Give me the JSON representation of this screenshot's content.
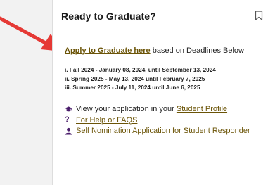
{
  "card": {
    "title": "Ready to Graduate?",
    "apply_link": "Apply to Graduate here",
    "apply_suffix": "based on Deadlines Below",
    "deadlines": [
      "i. Fall 2024 - January 08, 2024, until September 13, 2024",
      "ii. Spring 2025 - May 13, 2024 until February 7, 2025",
      "iii. Summer 2025 - July 11, 2024 until June 6, 2025"
    ],
    "resources": {
      "view_prefix": "View your application in your",
      "student_profile_link": "Student Profile",
      "help_link": "For Help or FAQS",
      "nomination_link": "Self Nomination Application for Student Responder"
    }
  },
  "icons": {
    "bookmark": "bookmark-icon",
    "graduation": "graduation-cap-icon",
    "help": "question-mark-icon",
    "user": "user-icon",
    "arrow": "red-arrow-annotation"
  },
  "colors": {
    "link": "#6b5407",
    "arrow": "#e53935",
    "icon_purple": "#4a1d6b"
  }
}
